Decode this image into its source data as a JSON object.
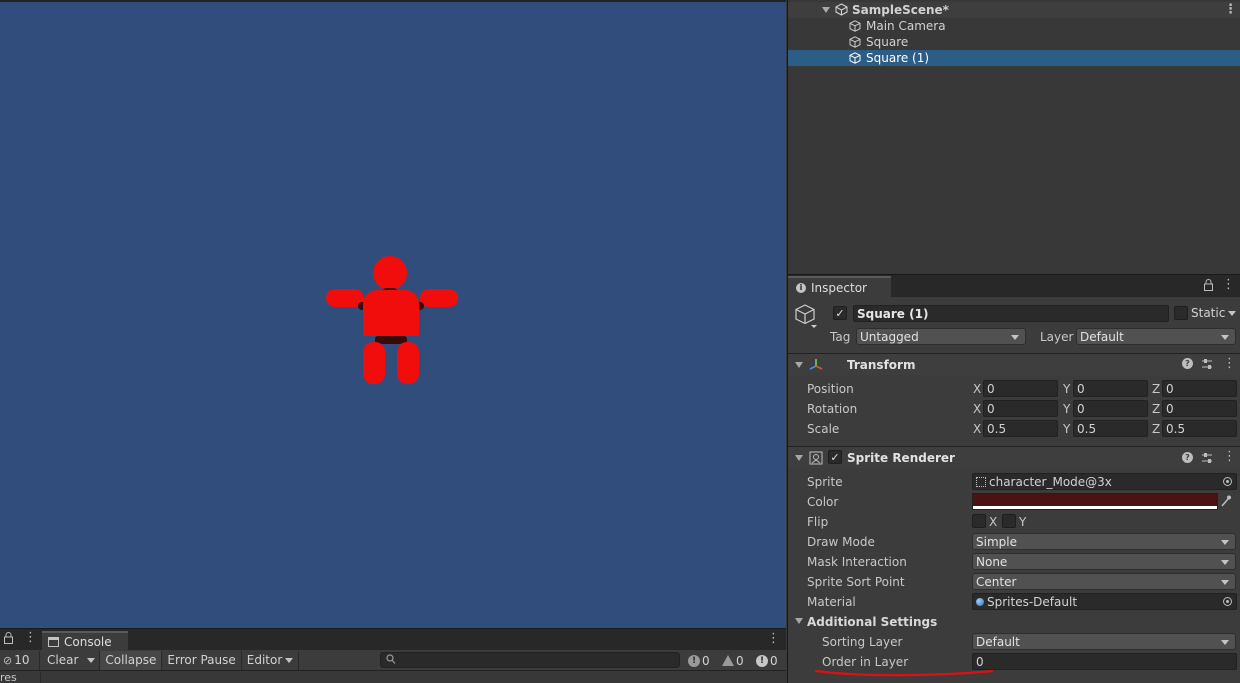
{
  "console": {
    "tab_label": "Console",
    "hidden_count": "10",
    "clear_label": "Clear",
    "collapse_label": "Collapse",
    "error_pause_label": "Error Pause",
    "editor_label": "Editor",
    "search_placeholder": "",
    "info_count": "0",
    "warning_count": "0",
    "error_count": "0",
    "partial_log_text": "res"
  },
  "hierarchy": {
    "scene_name": "SampleScene*",
    "items": [
      {
        "label": "Main Camera"
      },
      {
        "label": "Square"
      },
      {
        "label": "Square (1)"
      }
    ]
  },
  "inspector": {
    "tab_label": "Inspector",
    "object_name": "Square (1)",
    "static_label": "Static",
    "tag_label": "Tag",
    "tag_value": "Untagged",
    "layer_label": "Layer",
    "layer_value": "Default",
    "transform": {
      "title": "Transform",
      "position_label": "Position",
      "rotation_label": "Rotation",
      "scale_label": "Scale",
      "x": "X",
      "y": "Y",
      "z": "Z",
      "position": [
        "0",
        "0",
        "0"
      ],
      "rotation": [
        "0",
        "0",
        "0"
      ],
      "scale": [
        "0.5",
        "0.5",
        "0.5"
      ]
    },
    "sprite_renderer": {
      "title": "Sprite Renderer",
      "sprite_label": "Sprite",
      "sprite_value": "character_Mode@3x",
      "color_label": "Color",
      "color_value": "#4a1212",
      "flip_label": "Flip",
      "flip_x": "X",
      "flip_y": "Y",
      "draw_mode_label": "Draw Mode",
      "draw_mode_value": "Simple",
      "mask_interaction_label": "Mask Interaction",
      "mask_interaction_value": "None",
      "sprite_sort_point_label": "Sprite Sort Point",
      "sprite_sort_point_value": "Center",
      "material_label": "Material",
      "material_value": "Sprites-Default",
      "additional_settings_label": "Additional Settings",
      "sorting_layer_label": "Sorting Layer",
      "sorting_layer_value": "Default",
      "order_in_layer_label": "Order in Layer",
      "order_in_layer_value": "0"
    }
  },
  "colors": {
    "scene_bg": "#304d7b",
    "character": "#f20d0d",
    "selection": "#2c5d87",
    "annotation": "#e01010"
  }
}
